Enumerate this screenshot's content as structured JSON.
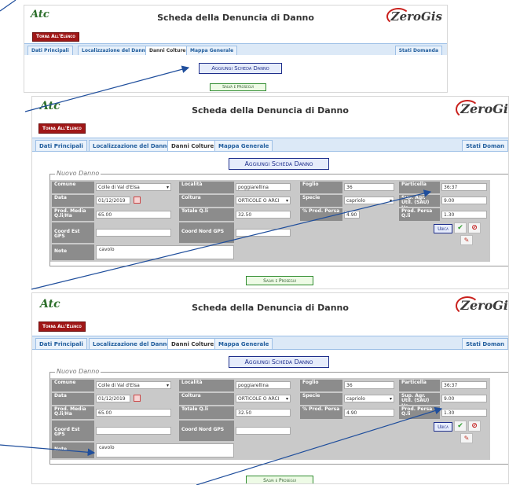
{
  "header": {
    "logo_text": "Atc",
    "logo_sub": "SIENA",
    "title": "Scheda della Denuncia di Danno",
    "brand_full": "ZeroGis",
    "brand_cut": "ZeroGi"
  },
  "back_label": "Torna All'Elenco",
  "tabs": [
    "Dati Principali",
    "Localizzazione del Danno",
    "Danni Colture",
    "Mappa Generale"
  ],
  "right_tab_full": "Stati Domanda",
  "right_tab_cut": "Stati Doman",
  "add_button": "Aggiungi Scheda Danno",
  "save_button": "Salva e Prosegui",
  "form": {
    "legend": "Nuovo Danno",
    "labels": {
      "comune": "Comune",
      "localita": "Località",
      "foglio": "Foglio",
      "particella": "Particella",
      "data": "Data",
      "coltura": "Coltura",
      "specie": "Specie",
      "sup": "Sup. Agr. Util. (SAU) Ha",
      "prod_media": "Prod. Media Q.li/Ha",
      "totale": "Totale Q.li",
      "perc": "% Prod. Persa",
      "prod_persa": "Prod. Persa Q.li",
      "est": "Coord Est GPS",
      "nord": "Coord Nord GPS",
      "note": "Note"
    },
    "values": {
      "comune": "Colle di Val d'Elsa",
      "localita": "poggiarellina",
      "foglio": "36",
      "particella": "36:37",
      "data": "01/12/2019",
      "coltura": "ORTICOLE O ARCI",
      "specie": "capriolo",
      "sup": "9.00",
      "prod_media": "65.00",
      "totale": "32.50",
      "perc": "4.90",
      "prod_persa": "1.30",
      "est": "",
      "nord": "",
      "note": "cavolo"
    },
    "ubica": "Ubica"
  },
  "icons": {
    "confirm": "check-icon",
    "cancel": "cancel-icon",
    "edit": "eraser-icon"
  },
  "colors": {
    "back_button": "#a01717",
    "tab_bar": "#dce9f7",
    "label_cell": "#8c8c8c",
    "arrow": "#1f4e9c",
    "brand_swoosh": "#c9201c"
  }
}
